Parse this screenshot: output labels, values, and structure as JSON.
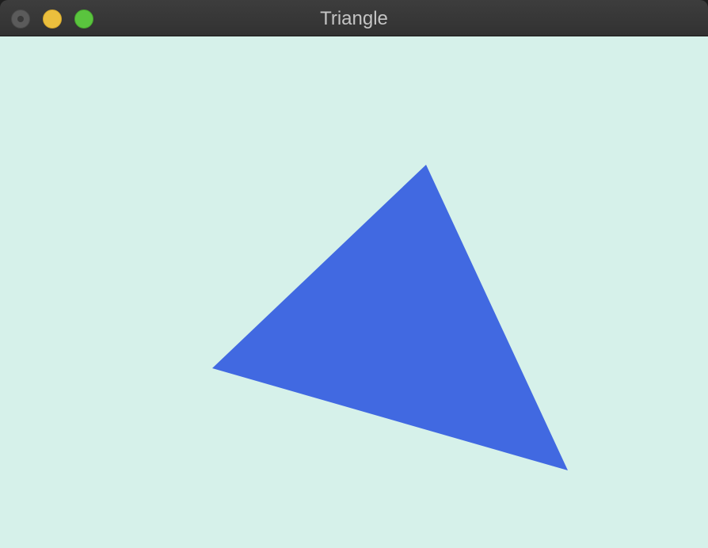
{
  "window": {
    "title": "Triangle",
    "controls": [
      {
        "name": "close",
        "color": "#5b5b5b"
      },
      {
        "name": "minimize",
        "color": "#ebbf3d"
      },
      {
        "name": "zoom",
        "color": "#5ac43e"
      }
    ]
  },
  "canvas": {
    "background": "#d6f1ea",
    "shape": {
      "type": "triangle",
      "fill": "#4169e1"
    }
  }
}
